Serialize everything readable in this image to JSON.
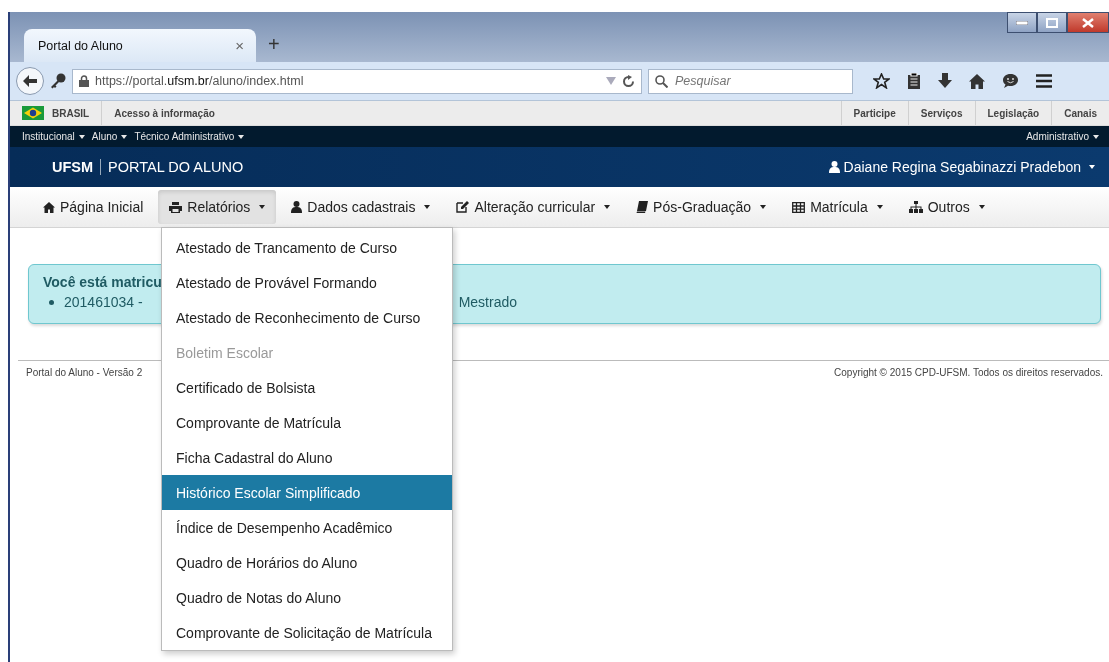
{
  "browser": {
    "tab_title": "Portal do Aluno",
    "tab_close": "×",
    "new_tab": "+",
    "url_prefix": "https://portal.",
    "url_domain": "ufsm.br",
    "url_path": "/aluno/index.html",
    "search_placeholder": "Pesquisar"
  },
  "gov_bar": {
    "left": [
      {
        "label": "BRASIL",
        "kind": "flag"
      },
      {
        "label": "Acesso à informação",
        "kind": "link"
      }
    ],
    "right": [
      "Participe",
      "Serviços",
      "Legislação",
      "Canais"
    ]
  },
  "top_menu": {
    "left": [
      "Institucional",
      "Aluno",
      "Técnico Administrativo"
    ],
    "right": [
      "Administrativo"
    ]
  },
  "header": {
    "brand": "UFSM",
    "title": "PORTAL DO ALUNO",
    "user": "Daiane Regina Segabinazzi Pradebon"
  },
  "nav": [
    {
      "label": "Página Inicial",
      "kind": "home",
      "dropdown": false,
      "selected": false
    },
    {
      "label": "Relatórios",
      "kind": "print",
      "dropdown": true,
      "selected": true
    },
    {
      "label": "Dados cadastrais",
      "kind": "user",
      "dropdown": true,
      "selected": false
    },
    {
      "label": "Alteração curricular",
      "kind": "edit",
      "dropdown": true,
      "selected": false
    },
    {
      "label": "Pós-Graduação",
      "kind": "book",
      "dropdown": true,
      "selected": false
    },
    {
      "label": "Matrícula",
      "kind": "table",
      "dropdown": true,
      "selected": false
    },
    {
      "label": "Outros",
      "kind": "sitemap",
      "dropdown": true,
      "selected": false
    }
  ],
  "dropdown": [
    {
      "label": "Atestado de Trancamento de Curso",
      "disabled": false,
      "selected": false
    },
    {
      "label": "Atestado de Provável Formando",
      "disabled": false,
      "selected": false
    },
    {
      "label": "Atestado de Reconhecimento de Curso",
      "disabled": false,
      "selected": false
    },
    {
      "label": "Boletim Escolar",
      "disabled": true,
      "selected": false
    },
    {
      "label": "Certificado de Bolsista",
      "disabled": false,
      "selected": false
    },
    {
      "label": "Comprovante de Matrícula",
      "disabled": false,
      "selected": false
    },
    {
      "label": "Ficha Cadastral do Aluno",
      "disabled": false,
      "selected": false
    },
    {
      "label": "Histórico Escolar Simplificado",
      "disabled": false,
      "selected": true
    },
    {
      "label": "Índice de Desempenho Acadêmico",
      "disabled": false,
      "selected": false
    },
    {
      "label": "Quadro de Horários do Aluno",
      "disabled": false,
      "selected": false
    },
    {
      "label": "Quadro de Notas do Aluno",
      "disabled": false,
      "selected": false
    },
    {
      "label": "Comprovante de Solicitação de Matrícula",
      "disabled": false,
      "selected": false
    }
  ],
  "alert": {
    "title": "Você está matricu",
    "item_start": "201461034 -",
    "item_end": "Mestrado"
  },
  "footer": {
    "left": "Portal do Aluno - Versão 2",
    "right": "Copyright © 2015 CPD-UFSM. Todos os direitos reservados."
  }
}
